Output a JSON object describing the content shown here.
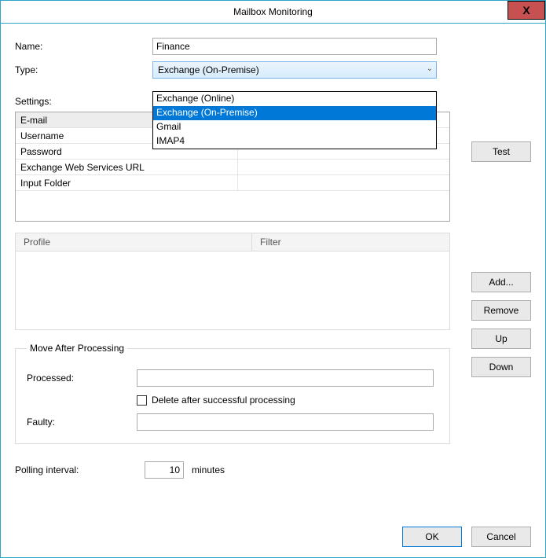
{
  "window": {
    "title": "Mailbox Monitoring"
  },
  "labels": {
    "name": "Name:",
    "type": "Type:",
    "settings": "Settings:",
    "profile": "Profile",
    "filter": "Filter",
    "move_group": "Move After Processing",
    "processed": "Processed:",
    "delete_after": "Delete after successful processing",
    "faulty": "Faulty:",
    "polling": "Polling interval:",
    "minutes": "minutes"
  },
  "values": {
    "name": "Finance",
    "type_selected": "Exchange (On-Premise)",
    "processed": "",
    "faulty": "",
    "delete_checked": false,
    "polling": "10"
  },
  "type_options": [
    "Exchange (Online)",
    "Exchange (On-Premise)",
    "Gmail",
    "IMAP4"
  ],
  "settings_rows": [
    "E-mail",
    "Username",
    "Password",
    "Exchange Web Services URL",
    "Input Folder"
  ],
  "buttons": {
    "test": "Test",
    "add": "Add...",
    "remove": "Remove",
    "up": "Up",
    "down": "Down",
    "ok": "OK",
    "cancel": "Cancel"
  }
}
